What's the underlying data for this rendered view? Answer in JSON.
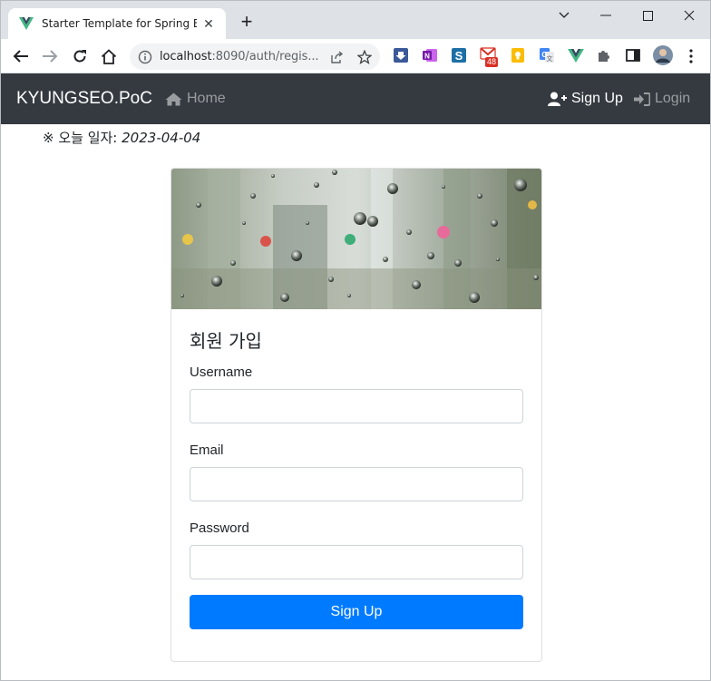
{
  "browser": {
    "tab_title": "Starter Template for Spring Boot",
    "url_host": "localhost",
    "url_rest": ":8090/auth/regis...",
    "gmail_badge": "48",
    "colors": {
      "tabstrip": "#dee1e6",
      "omnibox": "#f1f3f4"
    }
  },
  "navbar": {
    "brand": "KYUNGSEO.PoC",
    "home_label": "Home",
    "signup_label": "Sign Up",
    "login_label": "Login",
    "colors": {
      "background": "#343a40",
      "active": "#ffffff",
      "muted": "#9a9da0"
    }
  },
  "today": {
    "prefix": "※ 오늘 일자:",
    "date": "2023-04-04"
  },
  "form": {
    "title": "회원 가입",
    "username_label": "Username",
    "username_value": "",
    "email_label": "Email",
    "email_value": "",
    "password_label": "Password",
    "password_value": "",
    "submit_label": "Sign Up",
    "colors": {
      "primary": "#007bff"
    }
  },
  "icons": [
    "vue-favicon",
    "close-icon",
    "plus-icon",
    "back-arrow-icon",
    "forward-arrow-icon",
    "reload-icon",
    "home-icon",
    "info-icon",
    "share-icon",
    "star-icon",
    "puzzle-icon",
    "sidebar-icon",
    "menu-dots-icon",
    "user-plus-icon",
    "sign-in-icon"
  ]
}
